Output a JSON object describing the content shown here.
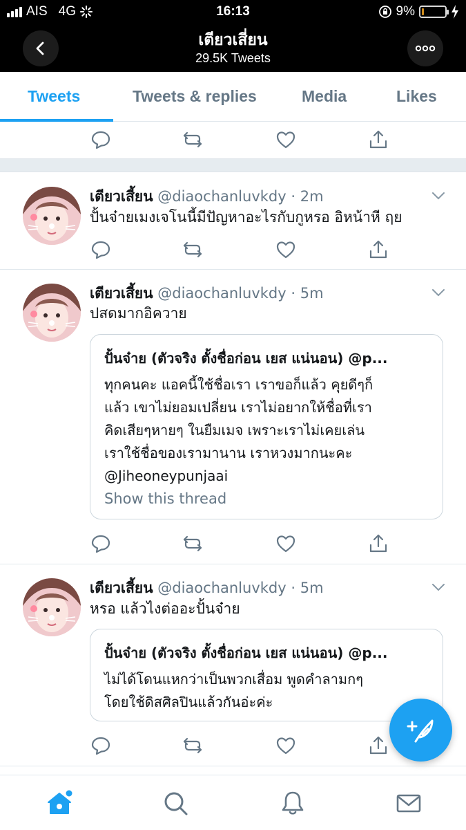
{
  "status_bar": {
    "carrier": "AIS",
    "network": "4G",
    "time": "16:13",
    "battery_percent": "9%",
    "battery_level": 0.09,
    "battery_color": "#f5a623"
  },
  "header": {
    "title": "เตียวเสี่ยน",
    "subtitle": "29.5K Tweets",
    "back_icon": "chevron-left-icon",
    "more_icon": "more-dots-icon"
  },
  "tabs": [
    {
      "label": "Tweets",
      "active": true
    },
    {
      "label": "Tweets & replies",
      "active": false
    },
    {
      "label": "Media",
      "active": false
    },
    {
      "label": "Likes",
      "active": false
    }
  ],
  "tweets": [
    {
      "name": "เตียวเสี้ยน",
      "handle": "@diaochanluvkdy",
      "time": "· 2m",
      "text": "ปั้นจ๋ายเมงเจโนนี้มีปัญหาอะไรกับกูหรอ อิหน้าหี ฤย"
    },
    {
      "name": "เตียวเสี้ยน",
      "handle": "@diaochanluvkdy",
      "time": "· 5m",
      "text": "ปสดมากอิควาย",
      "quote": {
        "header": "ปั้นจ๋าย (ตัวจริง ตั้งชื่อก่อน เยส แน่นอน) @p...",
        "lines": [
          "ทุกคนคะ แอคนี้ใช้ชื่อเรา เราขอก็แล้ว คุยดีๆก็",
          "แล้ว เขาไม่ยอมเปลี่ยน เราไม่อยากให้ชื่อที่เรา",
          "คิดเสียๆหายๆ ในยืมเมจ เพราะเราไม่เคยเล่น",
          "เราใช้ชื่อของเรามานาน เราหวงมากนะคะ",
          "@Jiheoneypunjaai"
        ],
        "link": "Show this thread"
      }
    },
    {
      "name": "เตียวเสี้ยน",
      "handle": "@diaochanluvkdy",
      "time": "· 5m",
      "text": "หรอ แล้วไงต่ออะปั้นจ๋าย",
      "quote": {
        "header": "ปั้นจ๋าย (ตัวจริง ตั้งชื่อก่อน เยส แน่นอน) @p...",
        "lines": [
          "ไม่ได้โดนแหกว่าเป็นพวกเสื่อม พูดคำลามกๆ",
          "โดยใช้ดิสศิลปินแล้วกันอ่ะค่ะ"
        ]
      }
    }
  ],
  "colors": {
    "accent": "#1da1f2",
    "secondary_text": "#657786",
    "border": "#e1e8ed"
  }
}
